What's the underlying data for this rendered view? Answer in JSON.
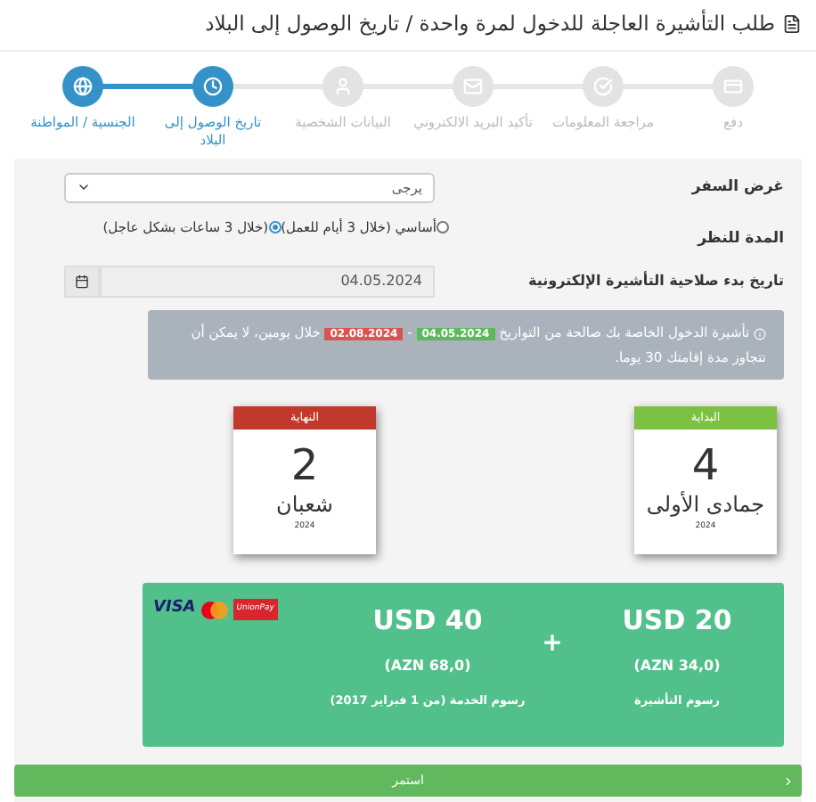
{
  "title": "طلب التأشيرة العاجلة للدخول لمرة واحدة / تاريخ الوصول إلى البلاد",
  "steps": [
    {
      "label": "دفع",
      "kind": "card",
      "selected": false
    },
    {
      "label": "مراجعة المعلومات",
      "kind": "check",
      "selected": false
    },
    {
      "label": "تأكيد البريد الالكتروني",
      "kind": "mail",
      "selected": false
    },
    {
      "label": "البيانات الشخصية",
      "kind": "user",
      "selected": false
    },
    {
      "label": "تاريخ الوصول إلى البلاد",
      "kind": "clock",
      "selected": true
    },
    {
      "label": "الجنسية / المواطنة",
      "kind": "globe",
      "selected": true
    }
  ],
  "form": {
    "purpose": {
      "label": "غرض السفر",
      "value": "يرجى"
    },
    "processing": {
      "label": "المدة للنظر",
      "options": [
        {
          "label": "أساسي (خلال 3 أيام للعمل)",
          "selected": false
        },
        {
          "label": "(خلال 3 ساعات بشكل عاجل)",
          "selected": true
        }
      ]
    },
    "start_date": {
      "label": "تاريخ بدء صلاحية التأشيرة الإلكترونية",
      "value": "04.05.2024"
    }
  },
  "notice": {
    "before": "تأشيرة الدخول الخاصة بك صالحة من التواريخ",
    "from": "04.05.2024",
    "separator": "-",
    "to": "02.08.2024",
    "after": "خلال يومين، لا يمكن أن تتجاوز مدة إقامتك 30 يوما."
  },
  "calendars": [
    {
      "header": "البداية",
      "day": "4",
      "month": "جمادى الأولى",
      "year": "2024",
      "color": "#7cc142"
    },
    {
      "header": "النهاية",
      "day": "2",
      "month": "شعبان",
      "year": "2024",
      "color": "#c0392b"
    }
  ],
  "fees": [
    {
      "amount": "USD 20",
      "local": "(AZN 34,0)",
      "label": "رسوم التأشيرة"
    },
    {
      "amount": "USD 40",
      "local": "(AZN 68,0)",
      "label": "رسوم الخدمة (من 1 فبراير 2017)"
    }
  ],
  "fee_joiner": "+",
  "card_logos": {
    "visa": "VISA",
    "unionpay": "UnionPay"
  },
  "continue_button": "استمر"
}
